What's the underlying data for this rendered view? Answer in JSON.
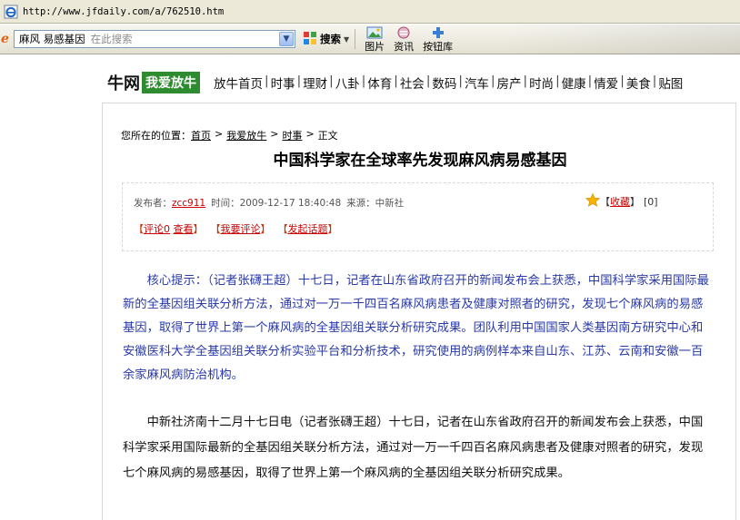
{
  "browser": {
    "url": "http://www.jfdaily.com/a/762510.htm"
  },
  "toolbar": {
    "search_query": "麻风 易感基因",
    "search_placeholder": "在此搜索",
    "search_button": "搜索",
    "images_button": "图片",
    "news_button": "资讯",
    "bookmark_button": "按钮库"
  },
  "site": {
    "logo": "牛网",
    "logo_tag": "我爱放牛",
    "nav": [
      "放牛首页",
      "时事",
      "理财",
      "八卦",
      "体育",
      "社会",
      "数码",
      "汽车",
      "房产",
      "时尚",
      "健康",
      "情爱",
      "美食",
      "贴图"
    ]
  },
  "article": {
    "breadcrumb_prefix": "您所在的位置：",
    "breadcrumb": [
      "首页",
      "我爱放牛",
      "时事",
      "正文"
    ],
    "title": "中国科学家在全球率先发现麻风病易感基因",
    "publisher_label": "发布者：",
    "publisher": "zcc911",
    "time": "时间：2009-12-17 18:40:48",
    "source": "来源：中新社",
    "favorite": "收藏",
    "favorite_count": "[0]",
    "comment": "评论0",
    "view": "查看",
    "my_comment": "我要评论",
    "start_topic": "发起话题",
    "summary": "核心提示：（记者张礴王超）十七日，记者在山东省政府召开的新闻发布会上获悉，中国科学家采用国际最新的全基因组关联分析方法，通过对一万一千四百名麻风病患者及健康对照者的研究，发现七个麻风病的易感基因，取得了世界上第一个麻风病的全基因组关联分析研究成果。团队利用中国国家人类基因南方研究中心和安徽医科大学全基因组关联分析实验平台和分析技术，研究使用的病例样本来自山东、江苏、云南和安徽一百余家麻风病防治机构。",
    "body": "中新社济南十二月十七日电（记者张礴王超）十七日，记者在山东省政府召开的新闻发布会上获悉，中国科学家采用国际最新的全基因组关联分析方法，通过对一万一千四百名麻风病患者及健康对照者的研究，发现七个麻风病的易感基因，取得了世界上第一个麻风病的全基因组关联分析研究成果。"
  }
}
